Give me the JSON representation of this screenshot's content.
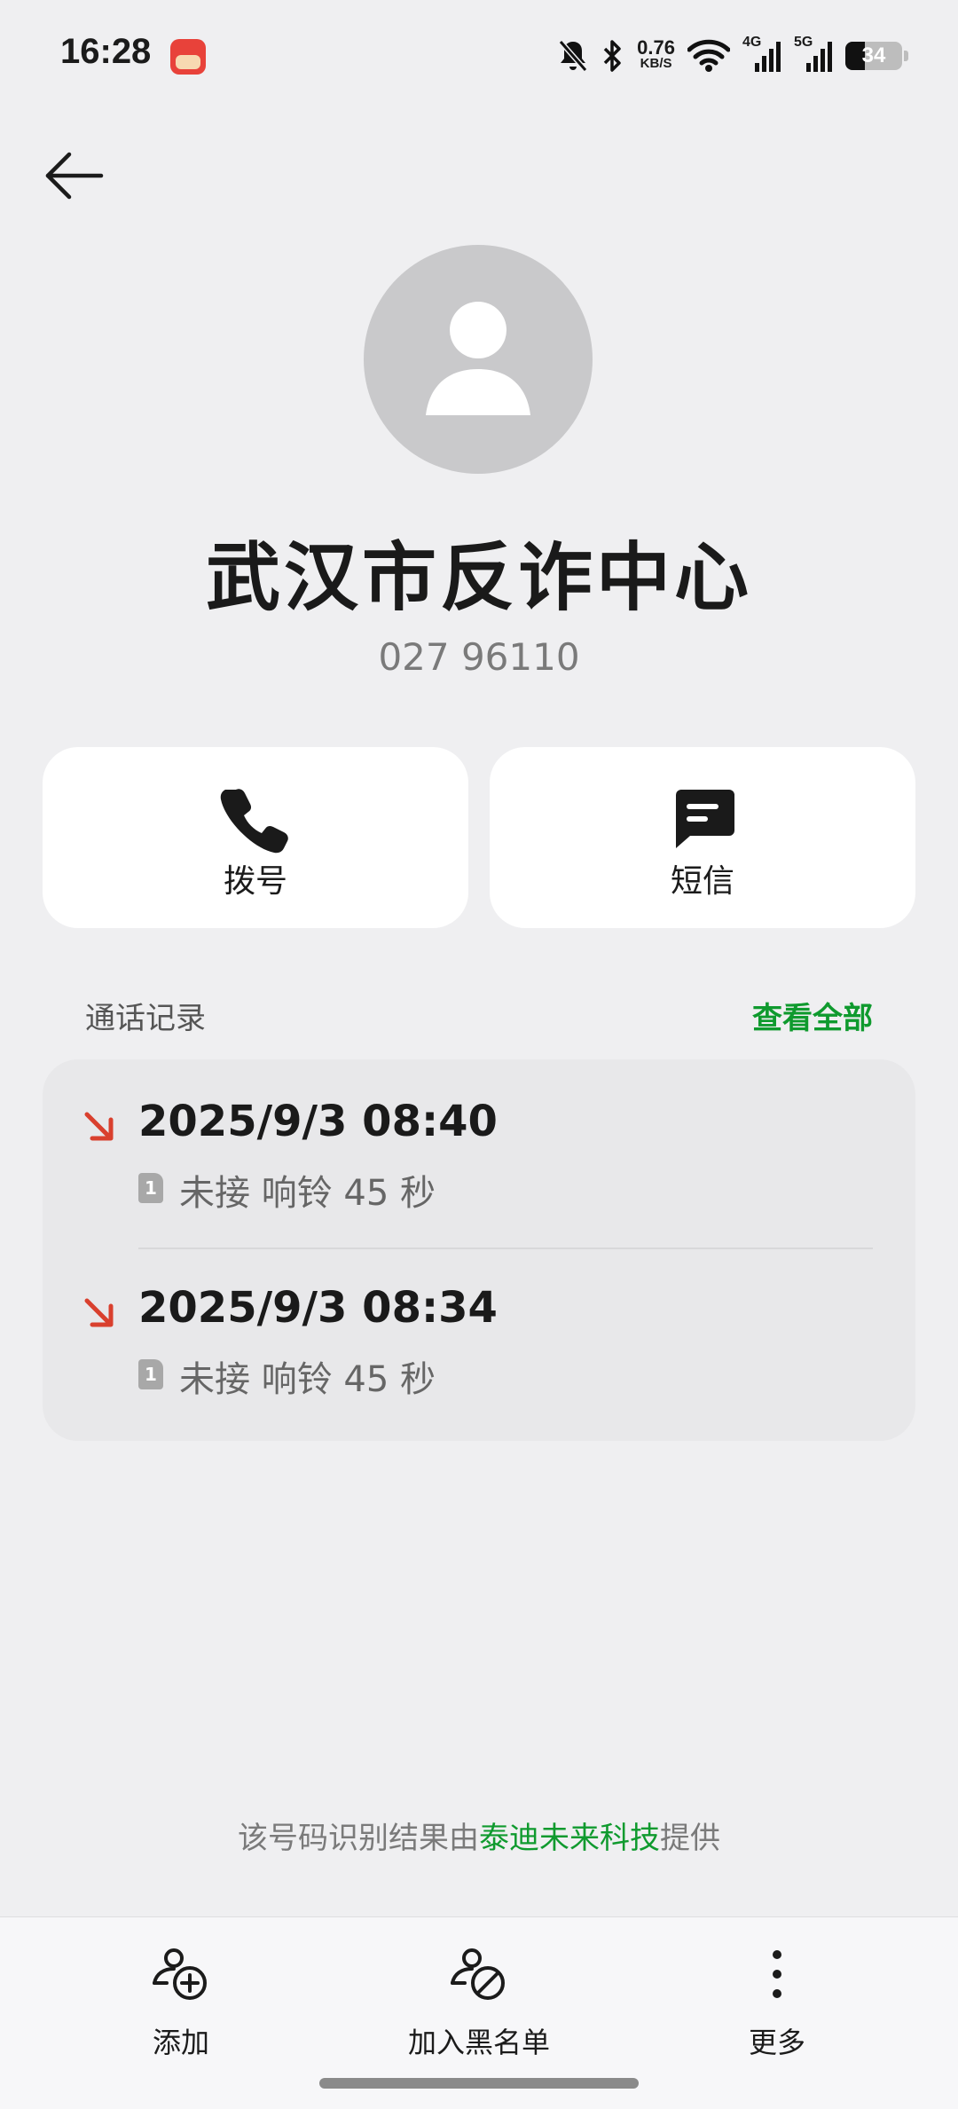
{
  "status_bar": {
    "time": "16:28",
    "net_speed_value": "0.76",
    "net_speed_unit": "KB/S",
    "sim1_network": "4G",
    "sim2_network": "5G",
    "battery": "34"
  },
  "contact": {
    "name": "武汉市反诈中心",
    "number": "027 96110"
  },
  "actions": {
    "dial_label": "拨号",
    "sms_label": "短信"
  },
  "call_log": {
    "title": "通话记录",
    "view_all": "查看全部",
    "entries": [
      {
        "time": "2025/9/3 08:40",
        "sim": "1",
        "status": "未接  响铃 45 秒"
      },
      {
        "time": "2025/9/3 08:34",
        "sim": "1",
        "status": "未接  响铃 45 秒"
      }
    ]
  },
  "credit": {
    "prefix": "该号码识别结果由",
    "provider": "泰迪未来科技",
    "suffix": "提供"
  },
  "bottom_bar": {
    "add_label": "添加",
    "blacklist_label": "加入黑名单",
    "more_label": "更多"
  },
  "colors": {
    "accent_green": "#0f9a2e",
    "missed_red": "#d9402e"
  },
  "icons": [
    "back-arrow-icon",
    "avatar-person-icon",
    "phone-icon",
    "message-icon",
    "missed-call-icon",
    "sim-icon",
    "add-contact-icon",
    "block-contact-icon",
    "more-icon"
  ]
}
